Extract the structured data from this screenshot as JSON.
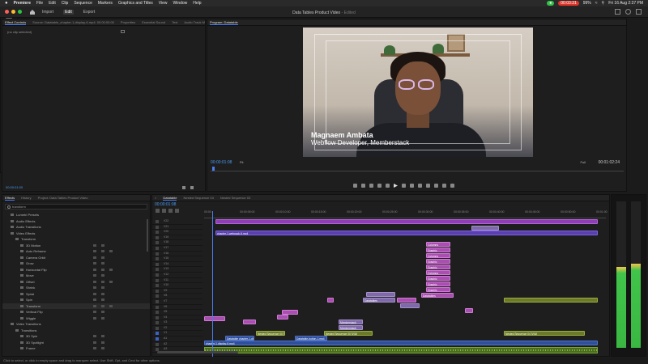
{
  "menubar": {
    "apple": "",
    "app": "Premiere",
    "items": [
      "File",
      "Edit",
      "Clip",
      "Sequence",
      "Markers",
      "Graphics and Titles",
      "View",
      "Window",
      "Help"
    ],
    "recording": "00:03:31",
    "battery": "99%",
    "datetime": "Fri 16 Aug 2:37 PM"
  },
  "header": {
    "workspace_tabs": [
      "Import",
      "Edit",
      "Export"
    ],
    "active_tab": "Edit",
    "project_title": "Data Tables Product Video",
    "edited_label": "- Edited"
  },
  "effect_controls": {
    "tabs": [
      "Effect Controls",
      "Source: Datatable_chapter-1-display-6.mp4: 00:00:00:00",
      "Properties",
      "Essential Sound",
      "Text",
      "Audio Track M"
    ],
    "empty_label": "(no clip selected)",
    "timecode": "00:00:01:00"
  },
  "program": {
    "tab": "Program: Datatable",
    "name_title": "Magnaem Ambata",
    "role_title": "Webflow Developer, Memberstack",
    "timecode_current": "00:00:01:08",
    "fit_left": "Fit",
    "fit_right": "Full",
    "timecode_duration": "00:01:02:24"
  },
  "effects": {
    "tabs": [
      "Effects",
      "History",
      "Project: Data Tables Product Video"
    ],
    "search_value": "transform",
    "items": [
      {
        "label": "Lumetri Presets",
        "indent": 1,
        "badges": 0
      },
      {
        "label": "Audio Effects",
        "indent": 1,
        "badges": 0
      },
      {
        "label": "Audio Transitions",
        "indent": 1,
        "badges": 0
      },
      {
        "label": "Video Effects",
        "indent": 1,
        "badges": 0
      },
      {
        "label": "Transform",
        "indent": 2,
        "badges": 0
      },
      {
        "label": "3D Motion",
        "indent": 3,
        "badges": 2
      },
      {
        "label": "Auto Reframe",
        "indent": 3,
        "badges": 3
      },
      {
        "label": "Camera Orbit",
        "indent": 3,
        "badges": 2
      },
      {
        "label": "Grow",
        "indent": 3,
        "badges": 2
      },
      {
        "label": "Horizontal Flip",
        "indent": 3,
        "badges": 3
      },
      {
        "label": "Move",
        "indent": 3,
        "badges": 2
      },
      {
        "label": "Offset",
        "indent": 3,
        "badges": 3
      },
      {
        "label": "Shrink",
        "indent": 3,
        "badges": 2
      },
      {
        "label": "Spiral",
        "indent": 3,
        "badges": 2
      },
      {
        "label": "Spin",
        "indent": 3,
        "badges": 2
      },
      {
        "label": "Transform",
        "indent": 3,
        "badges": 3,
        "highlight": true
      },
      {
        "label": "Vertical Flip",
        "indent": 3,
        "badges": 2
      },
      {
        "label": "Wiggle",
        "indent": 3,
        "badges": 2
      },
      {
        "label": "Video Transitions",
        "indent": 1,
        "badges": 0
      },
      {
        "label": "Transitions",
        "indent": 2,
        "badges": 0
      },
      {
        "label": "3D Spin",
        "indent": 3,
        "badges": 2
      },
      {
        "label": "3D Spotlight",
        "indent": 3,
        "badges": 2
      },
      {
        "label": "Frame",
        "indent": 3,
        "badges": 2
      }
    ]
  },
  "timeline": {
    "tabs": [
      "Datatable",
      "Nested Sequence 04",
      "Nested Sequence 03"
    ],
    "timecode": "00:00:01:08",
    "ruler": [
      "00:00",
      "00:00:05:00",
      "00:00:10:00",
      "00:00:15:00",
      "00:00:20:00",
      "00:00:25:00",
      "00:00:30:00",
      "00:00:35:00",
      "00:00:40:00",
      "00:00:45:00",
      "00:00:50:00",
      "00:01:00"
    ],
    "tracks_video": [
      "V22",
      "V21",
      "V20",
      "V19",
      "V18",
      "V17",
      "V16",
      "V15",
      "V14",
      "V13",
      "V12",
      "V11",
      "V10",
      "V9",
      "V8",
      "V7",
      "V6",
      "V5",
      "V4",
      "V3",
      "V2",
      "V1"
    ],
    "tracks_audio": [
      "A1",
      "A2",
      "A3"
    ],
    "clip_labels": {
      "subtitle": "Subtitle",
      "chapter": "chapter-1-webpack-6.mp4",
      "columns": "Columns",
      "graphic": "Graphic",
      "datatables": "Datatables",
      "nested_a": "Nested Sequence 00 [V/A]",
      "nested_b": "Nested Sequence 04 [V/A]",
      "datatable_chapter": "Datatable chapter-1-displa...",
      "datatable_button": "Datatable-button-1.mp4",
      "memberstack": "Memberstack",
      "chapter_display": "chapter-1-display-6.mp4"
    }
  },
  "status": {
    "hint": "Click to select, or click in empty space and drag to marquee select. Use Shift, Opt, and Cmd for other options."
  },
  "colors": {
    "accent": "#4a7cf0",
    "clip_purple": "#8e3fb3",
    "clip_olive": "#6b7a2a",
    "audio_green": "#4b6e1e"
  }
}
